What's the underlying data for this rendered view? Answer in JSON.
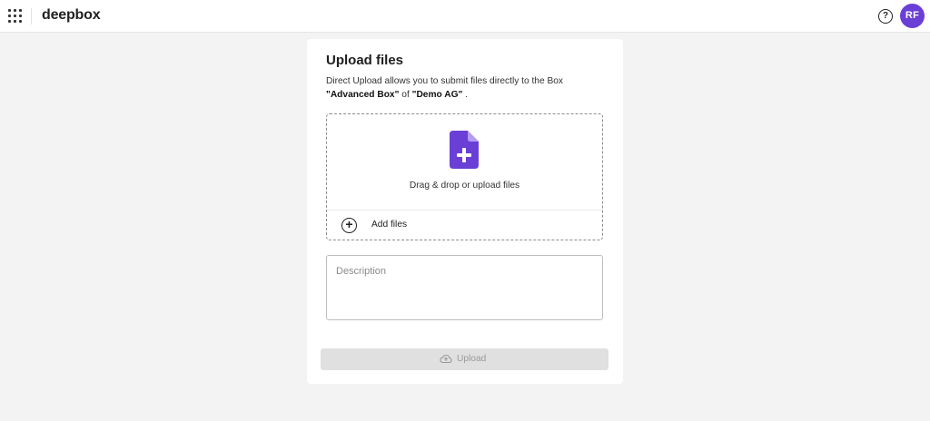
{
  "header": {
    "logo_text": "deepbox",
    "help_icon": "question-icon",
    "apps_icon": "grid-icon",
    "avatar_initials": "RF",
    "avatar_color": "#6a3fd6"
  },
  "upload": {
    "title": "Upload files",
    "intro_text": "Direct Upload allows you to submit files directly to the Box",
    "box_name": "\"Advanced Box\"",
    "of_text": "of",
    "org_name": "\"Demo AG\"",
    "period": ".",
    "dropzone_text": "Drag & drop or upload files",
    "dropzone_icon": "file-plus-icon",
    "accent_color": "#6a3fd6",
    "add_files_label": "Add files",
    "add_files_icon": "plus-circle-icon",
    "description_placeholder": "Description",
    "description_value": "",
    "upload_button_label": "Upload",
    "upload_button_icon": "cloud-upload-icon"
  }
}
